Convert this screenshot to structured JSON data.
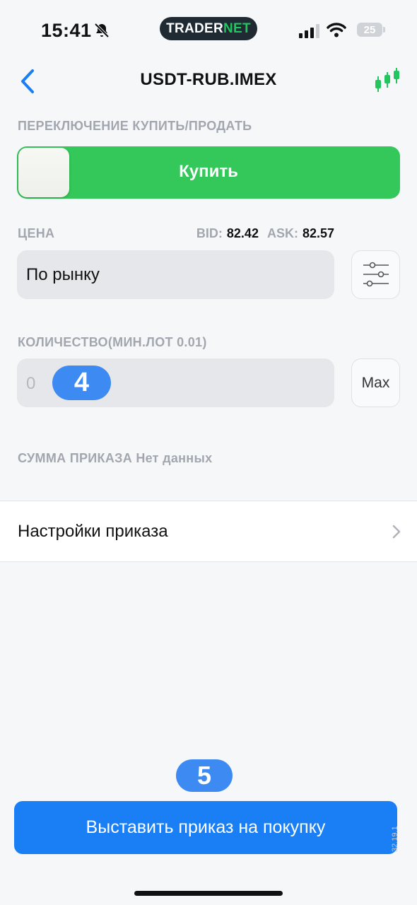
{
  "status_bar": {
    "time": "15:41",
    "brand_part1": "TRADER",
    "brand_part2": "NET",
    "battery": "25"
  },
  "header": {
    "title": "USDT-RUB.IMEX",
    "back_icon": "chevron-left-icon",
    "chart_icon": "candlestick-chart-icon"
  },
  "toggle": {
    "label": "ПЕРЕКЛЮЧЕНИЕ КУПИТЬ/ПРОДАТЬ",
    "state_text": "Купить",
    "color": "#34c759"
  },
  "price": {
    "label": "ЦЕНА",
    "bid_label": "BID:",
    "bid_value": "82.42",
    "ask_label": "ASK:",
    "ask_value": "82.57",
    "value": "По рынку",
    "settings_icon": "sliders-icon"
  },
  "quantity": {
    "label": "КОЛИЧЕСТВО(МИН.ЛОТ 0.01)",
    "placeholder": "0",
    "max_label": "Max"
  },
  "order_sum": {
    "label": "СУММА ПРИКАЗА",
    "value": "Нет данных"
  },
  "order_settings": {
    "label": "Настройки приказа"
  },
  "annotations": {
    "step_4": "4",
    "step_5": "5"
  },
  "submit": {
    "label": "Выставить приказ на покупку",
    "color": "#1a7ff5"
  },
  "version": "32.19.1"
}
